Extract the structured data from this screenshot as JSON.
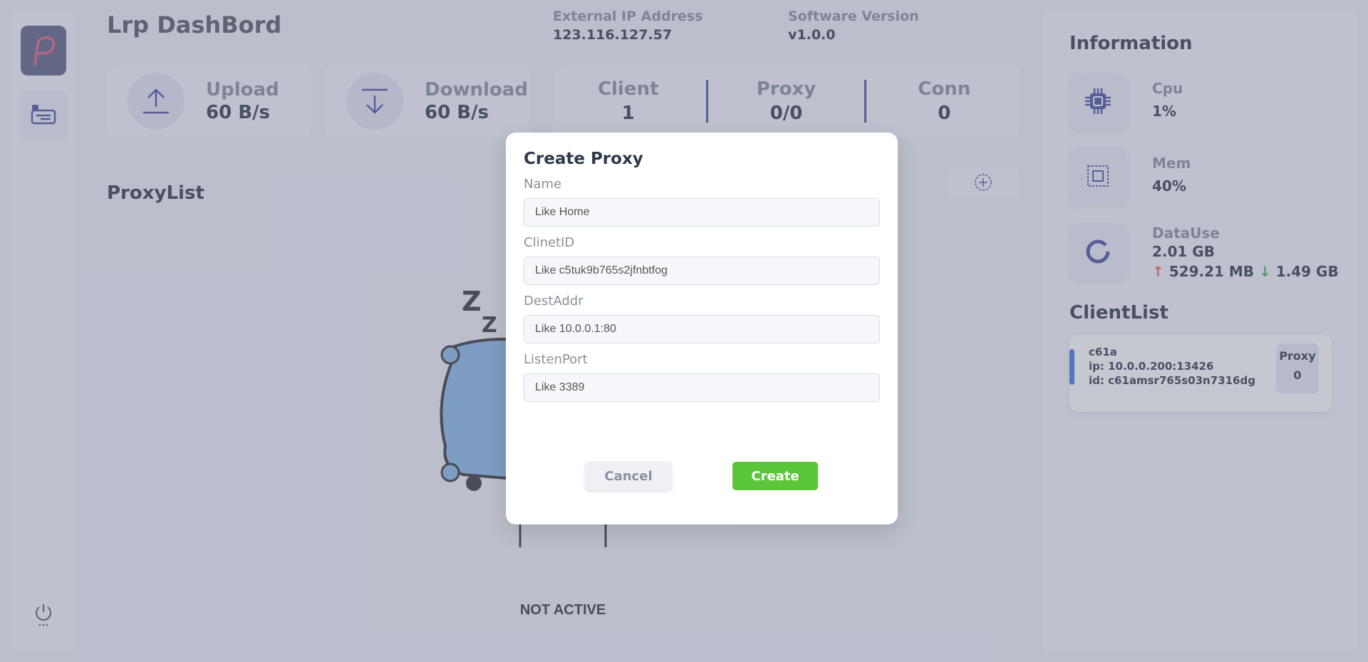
{
  "app": {
    "title": "Lrp DashBord"
  },
  "header": {
    "external_ip_label": "External IP Address",
    "external_ip_value": "123.116.127.57",
    "version_label": "Software Version",
    "version_value": "v1.0.0"
  },
  "traffic": {
    "upload_label": "Upload",
    "upload_value": "60 B/s",
    "download_label": "Download",
    "download_value": "60 B/s"
  },
  "stats": {
    "client_label": "Client",
    "client_value": "1",
    "proxy_label": "Proxy",
    "proxy_value": "0/0",
    "conn_label": "Conn",
    "conn_value": "0"
  },
  "proxy_list": {
    "title": "ProxyList",
    "empty_text": "NOT ACTIVE"
  },
  "info": {
    "title": "Information",
    "cpu_label": "Cpu",
    "cpu_value": "1%",
    "mem_label": "Mem",
    "mem_value": "40%",
    "datause_label": "DataUse",
    "datause_value": "2.01 GB",
    "datause_up": "529.21 MB",
    "datause_down": "1.49 GB"
  },
  "client_list": {
    "title": "ClientList",
    "items": [
      {
        "name": "c61a",
        "ip": "ip: 10.0.0.200:13426",
        "id": "id: c61amsr765s03n7316dg",
        "proxy_label": "Proxy",
        "proxy_count": "0"
      }
    ]
  },
  "modal": {
    "title": "Create Proxy",
    "name_label": "Name",
    "name_placeholder": "Like Home",
    "clientid_label": "ClinetID",
    "clientid_placeholder": "Like c5tuk9b765s2jfnbtfog",
    "destaddr_label": "DestAddr",
    "destaddr_placeholder": "Like 10.0.0.1:80",
    "listenport_label": "ListenPort",
    "listenport_placeholder": "Like 3389",
    "cancel_label": "Cancel",
    "create_label": "Create"
  },
  "icons": {
    "logo": "logo-icon",
    "nav": "list-icon",
    "power": "power-icon",
    "upload": "upload-icon",
    "download": "download-icon",
    "add": "plus-circle-icon",
    "cpu": "cpu-icon",
    "mem": "memory-icon",
    "datause": "donut-icon"
  },
  "colors": {
    "accent": "#4a4fa0",
    "create_button": "#5cc63a",
    "client_bar": "#3a7bdc",
    "up_arrow": "#e4683a",
    "down_arrow": "#46b04e"
  }
}
